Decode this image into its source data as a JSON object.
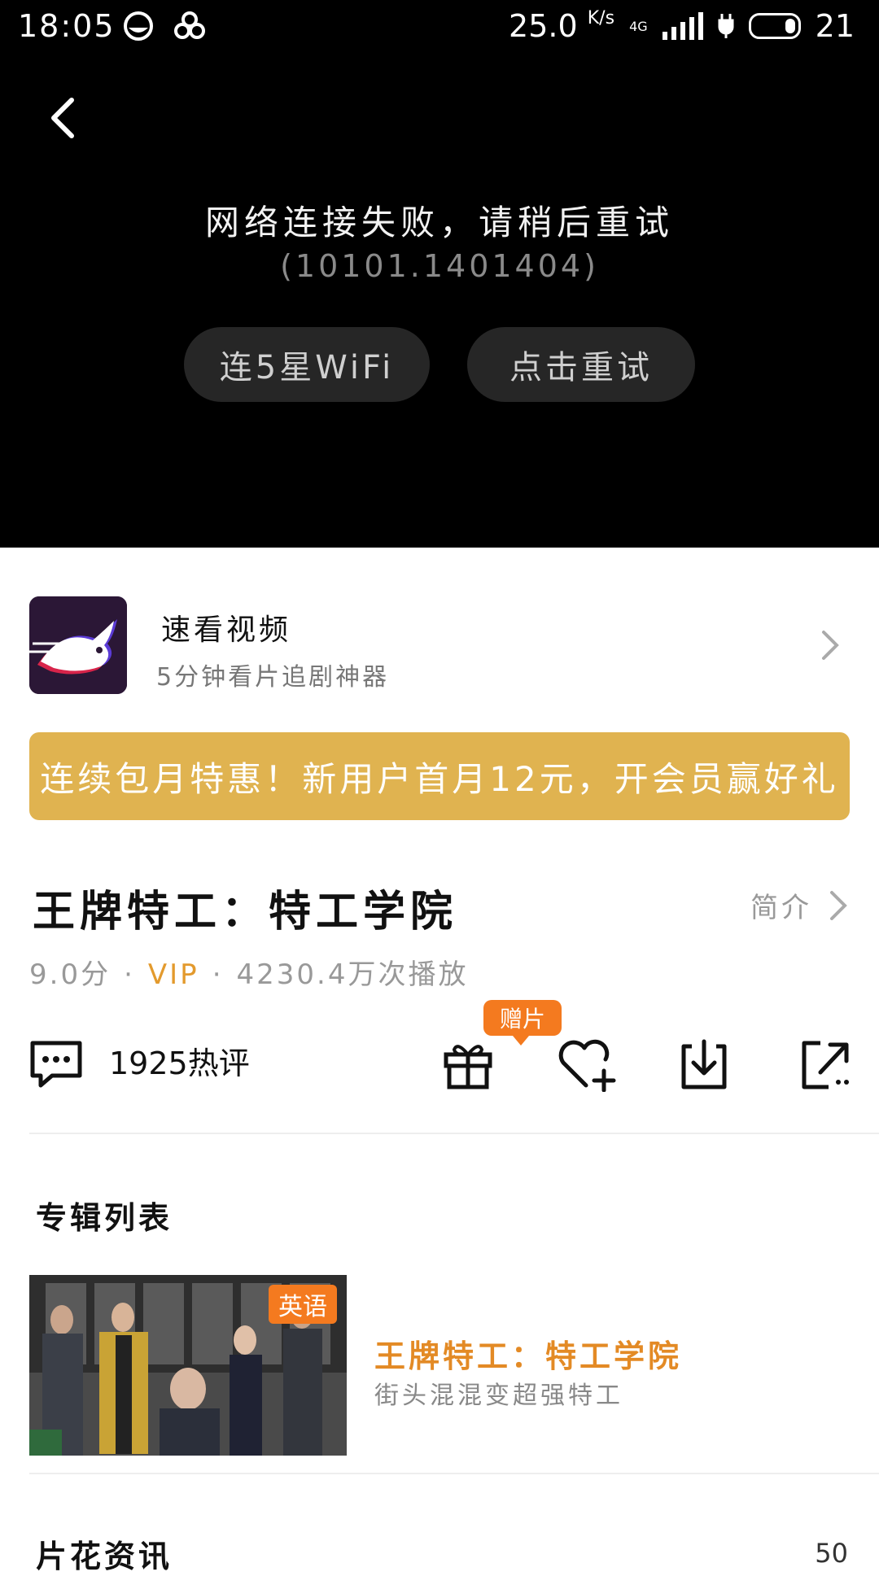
{
  "status_bar": {
    "time": "18:05",
    "speed": "25.0",
    "speed_unit": "K/s",
    "battery": "21",
    "network": "4G"
  },
  "player": {
    "error_title": "网络连接失败，请稍后重试",
    "error_code": "(10101.1401404)",
    "wifi_button": "连5星WiFi",
    "retry_button": "点击重试"
  },
  "app_promo": {
    "name": "速看视频",
    "subtitle": "5分钟看片追剧神器"
  },
  "banner": {
    "text": "连续包月特惠！新用户首月12元，开会员赢好礼"
  },
  "show": {
    "title": "王牌特工：特工学院",
    "intro_label": "简介",
    "score": "9.0分",
    "vip": "VIP",
    "plays": "4230.4万次播放"
  },
  "actions": {
    "comments": "1925热评",
    "gift_badge": "赠片"
  },
  "album": {
    "section_title": "专辑列表",
    "item_title": "王牌特工：特工学院",
    "item_subtitle": "街头混混变超强特工",
    "language_tag": "英语"
  },
  "news": {
    "section_title": "片花资讯",
    "count": "50"
  },
  "colors": {
    "accent_orange": "#f47a1f",
    "banner_gold": "#e0b350",
    "vip_orange": "#e39a2d"
  }
}
